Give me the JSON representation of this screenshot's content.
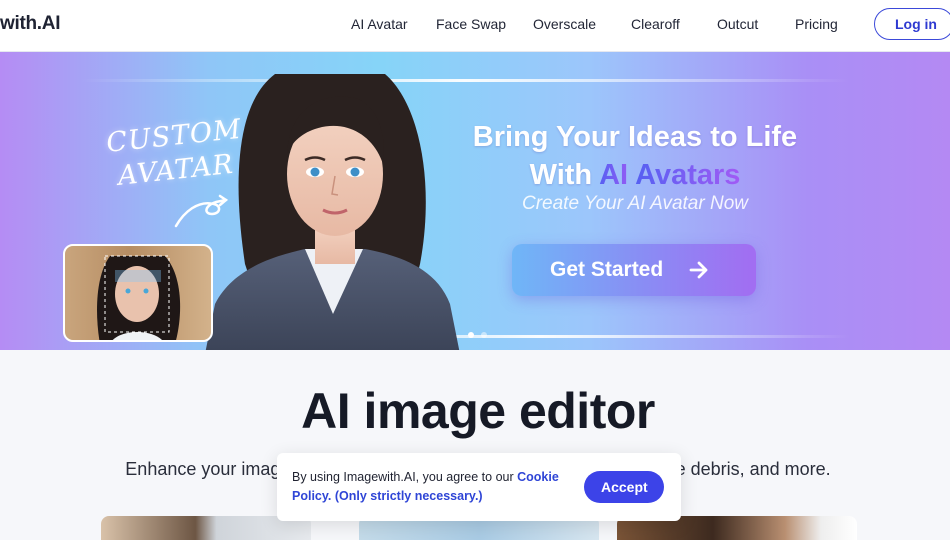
{
  "header": {
    "logo": "with.AI",
    "nav": [
      "AI Avatar",
      "Face Swap",
      "Overscale",
      "Clearoff",
      "Outcut",
      "Pricing"
    ],
    "login_label": "Log in"
  },
  "hero": {
    "handwritten_line1": "Custom",
    "handwritten_line2": "Avatar",
    "headline_line1": "Bring Your Ideas to Life",
    "headline_with": "With ",
    "headline_ai": "AI ",
    "headline_avatars": "Avatars",
    "subline": "Create Your AI Avatar Now",
    "cta_label": "Get Started",
    "slides": 2,
    "active_slide": 1
  },
  "main": {
    "title": "AI image editor",
    "description": "Enhance your images with ease, upscale, remove backgrounds, erase debris, and more."
  },
  "cookie": {
    "text": "By using Imagewith.AI, you agree to our ",
    "link": "Cookie Policy. (Only strictly necessary.)",
    "accept_label": "Accept"
  },
  "colors": {
    "brand_blue": "#3c43e8",
    "login_border": "#3b49d9",
    "hero_start": "#b58cf4",
    "hero_mid": "#86d4f8",
    "hero_end": "#b489f3"
  }
}
